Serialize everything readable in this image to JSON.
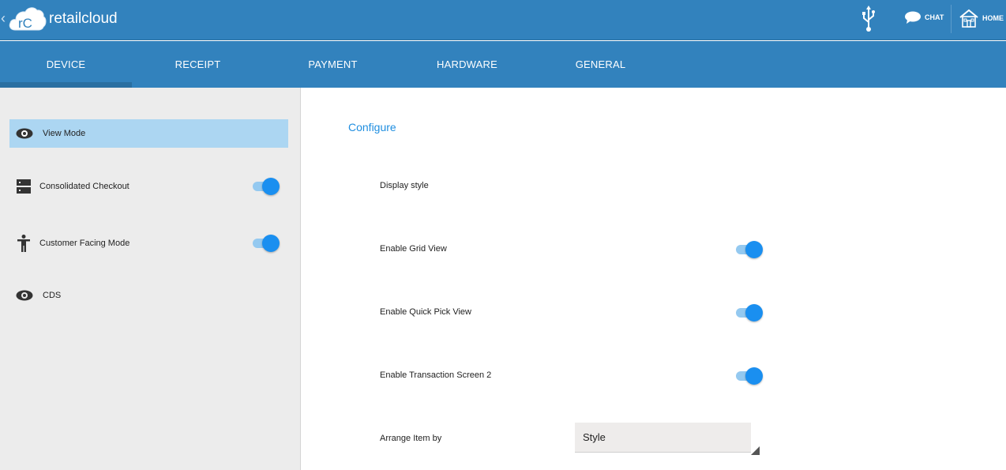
{
  "app": {
    "title": "retailcloud",
    "logo_text": "rC"
  },
  "header": {
    "back_glyph": "‹",
    "usb_icon": "usb-icon",
    "chat_label": "CHAT",
    "home_label": "HOME"
  },
  "tabs": [
    {
      "label": "DEVICE",
      "active": true
    },
    {
      "label": "RECEIPT",
      "active": false
    },
    {
      "label": "PAYMENT",
      "active": false
    },
    {
      "label": "HARDWARE",
      "active": false
    },
    {
      "label": "GENERAL",
      "active": false
    }
  ],
  "sidebar": {
    "items": [
      {
        "label": "View Mode",
        "icon": "eye-icon",
        "selected": true
      },
      {
        "label": "Consolidated Checkout",
        "icon": "server-icon",
        "toggle": true,
        "on": true
      },
      {
        "label": "Customer Facing Mode",
        "icon": "person-icon",
        "toggle": true,
        "on": true
      },
      {
        "label": "CDS",
        "icon": "eye-icon"
      }
    ]
  },
  "main": {
    "title": "Configure",
    "display_style_label": "Display style",
    "grid_view_label": "Enable Grid View",
    "quick_pick_label": "Enable Quick Pick View",
    "transaction_screen_label": "Enable Transaction Screen 2",
    "arrange_label": "Arrange Item by",
    "arrange_value": "Style"
  },
  "colors": {
    "header_bg": "#3282bd",
    "accent": "#1a8ff0",
    "selected_bg": "#acd6f2",
    "sidebar_bg": "#ececec"
  }
}
